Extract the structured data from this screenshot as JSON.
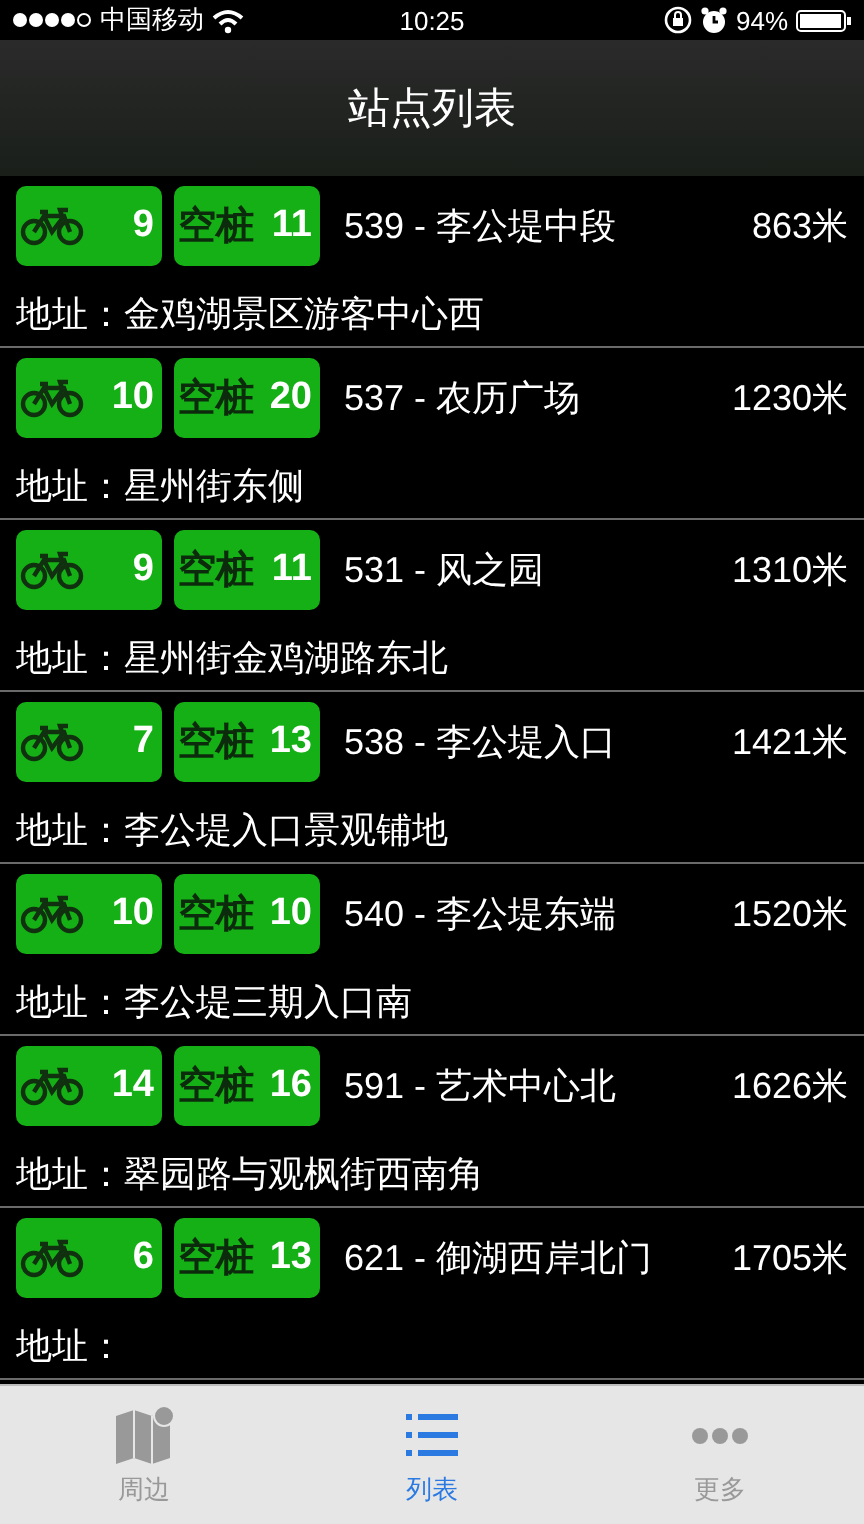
{
  "status_bar": {
    "carrier": "中国移动",
    "time": "10:25",
    "battery": "94%"
  },
  "title": "站点列表",
  "stations": [
    {
      "bikes": "9",
      "docks_label": "空桩",
      "docks": "11",
      "name": "539 - 李公堤中段",
      "distance": "863米",
      "address": "地址：金鸡湖景区游客中心西"
    },
    {
      "bikes": "10",
      "docks_label": "空桩",
      "docks": "20",
      "name": "537 - 农历广场",
      "distance": "1230米",
      "address": "地址：星州街东侧"
    },
    {
      "bikes": "9",
      "docks_label": "空桩",
      "docks": "11",
      "name": "531 - 风之园",
      "distance": "1310米",
      "address": "地址：星州街金鸡湖路东北"
    },
    {
      "bikes": "7",
      "docks_label": "空桩",
      "docks": "13",
      "name": "538 - 李公堤入口",
      "distance": "1421米",
      "address": "地址：李公堤入口景观铺地"
    },
    {
      "bikes": "10",
      "docks_label": "空桩",
      "docks": "10",
      "name": "540 - 李公堤东端",
      "distance": "1520米",
      "address": "地址：李公堤三期入口南"
    },
    {
      "bikes": "14",
      "docks_label": "空桩",
      "docks": "16",
      "name": "591 - 艺术中心北",
      "distance": "1626米",
      "address": "地址：翠园路与观枫街西南角"
    },
    {
      "bikes": "6",
      "docks_label": "空桩",
      "docks": "13",
      "name": "621 - 御湖西岸北门",
      "distance": "1705米",
      "address": "地址："
    }
  ],
  "tabs": [
    {
      "kind": "map",
      "label": "周边",
      "selected": false
    },
    {
      "kind": "list",
      "label": "列表",
      "selected": true
    },
    {
      "kind": "more",
      "label": "更多",
      "selected": false
    }
  ]
}
